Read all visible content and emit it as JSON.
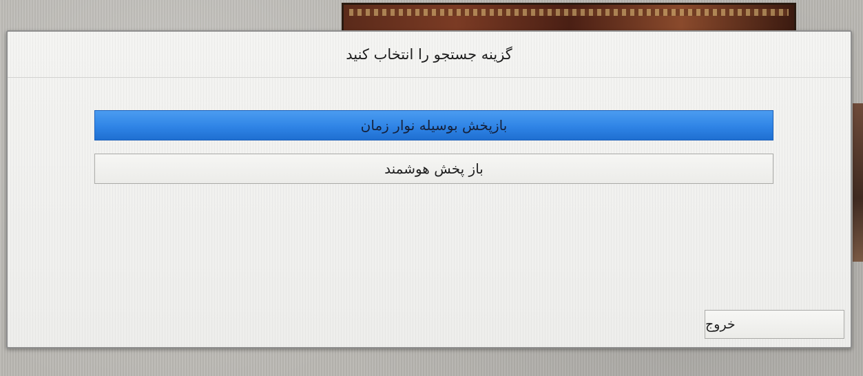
{
  "dialog": {
    "title": "گزینه جستجو را انتخاب کنید",
    "options": [
      {
        "label": "بازپخش بوسیله نوار زمان",
        "selected": true
      },
      {
        "label": "باز پخش هوشمند",
        "selected": false
      }
    ],
    "exit_label": "خروج"
  },
  "colors": {
    "selection": "#2f84e6",
    "dialog_background": "#f1f1ef",
    "border": "#8e8e8e"
  }
}
